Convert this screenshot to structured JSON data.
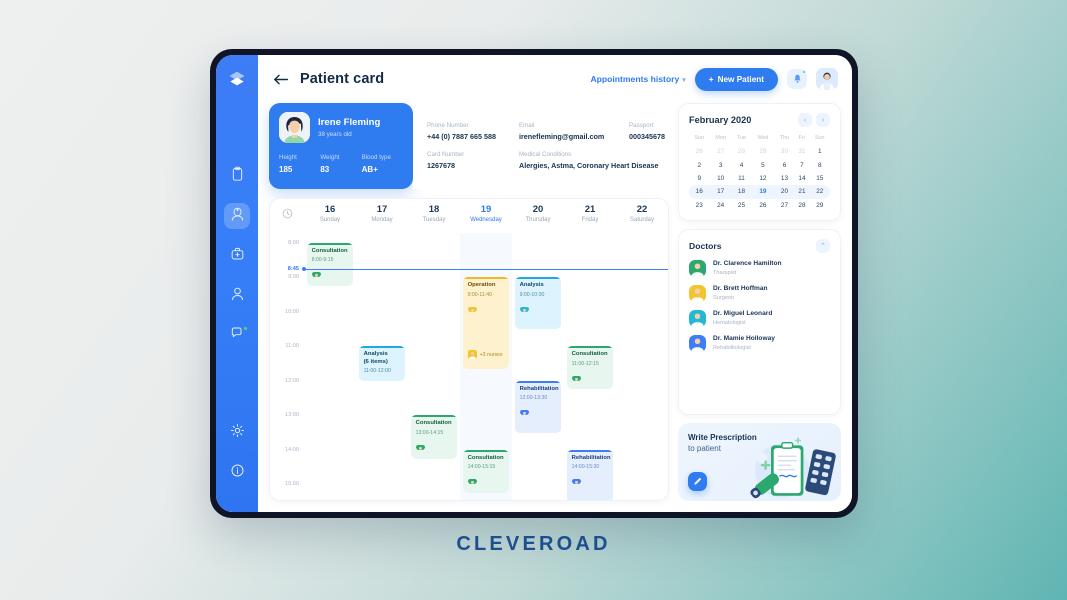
{
  "brand": "CLEVEROAD",
  "sidebar": {
    "logo_icon": "cleveroad-logo-icon",
    "items": [
      {
        "icon": "clipboard-icon",
        "name": "records",
        "active": false,
        "badge": false
      },
      {
        "icon": "nurse-icon",
        "name": "nurses",
        "active": true,
        "badge": false
      },
      {
        "icon": "medical-bag-icon",
        "name": "pharmacy",
        "active": false,
        "badge": false
      },
      {
        "icon": "doctor-icon",
        "name": "doctors",
        "active": false,
        "badge": false
      },
      {
        "icon": "chat-icon",
        "name": "messages",
        "active": false,
        "badge": true
      }
    ],
    "bottom_items": [
      {
        "icon": "gear-icon",
        "name": "settings"
      },
      {
        "icon": "info-icon",
        "name": "help"
      }
    ]
  },
  "topbar": {
    "back_icon": "arrow-left-icon",
    "title": "Patient card",
    "appointments_history": "Appointments history",
    "appointments_caret": "▾",
    "new_patient": "New Patient",
    "new_patient_plus": "+",
    "bell_icon": "bell-icon",
    "avatar_icon": "user-avatar"
  },
  "patient": {
    "name": "Irene Fleming",
    "age": "38 years old",
    "stats": [
      {
        "label": "Height",
        "value": "185"
      },
      {
        "label": "Weight",
        "value": "83"
      },
      {
        "label": "Blood type",
        "value": "AB+"
      }
    ],
    "details_row1": [
      {
        "label": "Phone Number",
        "value": "+44 (0) 7887 665 588"
      },
      {
        "label": "Email",
        "value": "irenefleming@gmail.com"
      },
      {
        "label": "Passport",
        "value": "000345678"
      }
    ],
    "details_row2": [
      {
        "label": "Card Number",
        "value": "1267678"
      },
      {
        "label": "Medical Conditions",
        "value": "Alergies, Astma, Coronary Heart Disease"
      }
    ]
  },
  "schedule": {
    "clock_icon": "clock-icon",
    "days": [
      {
        "num": "16",
        "name": "Sunday",
        "today": false
      },
      {
        "num": "17",
        "name": "Monday",
        "today": false
      },
      {
        "num": "18",
        "name": "Tuesday",
        "today": false
      },
      {
        "num": "19",
        "name": "Wednesday",
        "today": true
      },
      {
        "num": "20",
        "name": "Thursday",
        "today": false
      },
      {
        "num": "21",
        "name": "Friday",
        "today": false
      },
      {
        "num": "22",
        "name": "Saturday",
        "today": false
      }
    ],
    "time_labels": [
      "8:00",
      "9:00",
      "10:00",
      "11:00",
      "12:00",
      "13:00",
      "14:00",
      "15:00"
    ],
    "now_label": "8:45",
    "events": [
      {
        "title": "Consultation",
        "sub": "",
        "time": "8:00-9:15",
        "day": 0,
        "start": 8.0,
        "end": 9.25,
        "color": "green",
        "avatar": "doctor-green-avatar"
      },
      {
        "title": "Operation",
        "sub": "",
        "time": "9:00-11:40",
        "day": 3,
        "start": 9.0,
        "end": 11.67,
        "color": "yellow",
        "avatar": "nurse-yellow-avatar",
        "nurses": "+3 nurses"
      },
      {
        "title": "Analysis",
        "sub": "",
        "time": "9:00-10:30",
        "day": 4,
        "start": 9.0,
        "end": 10.5,
        "color": "cyan",
        "avatar": "doctor-cyan-avatar"
      },
      {
        "title": "Analysis",
        "sub": "(6 items)",
        "time": "11:00-12:00",
        "day": 1,
        "start": 11.0,
        "end": 12.0,
        "color": "cyan",
        "avatar": "doctor-cyan-avatar"
      },
      {
        "title": "Consultation",
        "sub": "",
        "time": "11:00-12:15",
        "day": 5,
        "start": 11.0,
        "end": 12.25,
        "color": "green",
        "avatar": "doctor-green-avatar"
      },
      {
        "title": "Rehabilitation",
        "sub": "",
        "time": "12:00-13:30",
        "day": 4,
        "start": 12.0,
        "end": 13.5,
        "color": "blue",
        "avatar": "doctor-blue-avatar"
      },
      {
        "title": "Consultation",
        "sub": "",
        "time": "13:00-14:15",
        "day": 2,
        "start": 13.0,
        "end": 14.25,
        "color": "green",
        "avatar": "doctor-green-avatar"
      },
      {
        "title": "Consultation",
        "sub": "",
        "time": "14:00-15:15",
        "day": 3,
        "start": 14.0,
        "end": 15.25,
        "color": "green",
        "avatar": "doctor-green-avatar"
      },
      {
        "title": "Rehabilitation",
        "sub": "",
        "time": "14:00-15:30",
        "day": 5,
        "start": 14.0,
        "end": 15.5,
        "color": "blue",
        "avatar": "doctor-blue-avatar"
      }
    ]
  },
  "calendar": {
    "month": "February 2020",
    "prev_icon": "chevron-left-icon",
    "next_icon": "chevron-right-icon",
    "weekdays": [
      "Sun",
      "Mon",
      "Tue",
      "Wed",
      "Thu",
      "Fri",
      "Sun"
    ],
    "weeks": [
      [
        {
          "d": "26",
          "mute": true
        },
        {
          "d": "27",
          "mute": true
        },
        {
          "d": "28",
          "mute": true
        },
        {
          "d": "29",
          "mute": true
        },
        {
          "d": "30",
          "mute": true
        },
        {
          "d": "31",
          "mute": true
        },
        {
          "d": "1",
          "mute": false
        }
      ],
      [
        {
          "d": "2",
          "mute": false
        },
        {
          "d": "3",
          "mute": false
        },
        {
          "d": "4",
          "mute": false
        },
        {
          "d": "5",
          "mute": false
        },
        {
          "d": "6",
          "mute": false
        },
        {
          "d": "7",
          "mute": false
        },
        {
          "d": "8",
          "mute": false
        }
      ],
      [
        {
          "d": "9",
          "mute": false
        },
        {
          "d": "10",
          "mute": false
        },
        {
          "d": "11",
          "mute": false
        },
        {
          "d": "12",
          "mute": false
        },
        {
          "d": "13",
          "mute": false
        },
        {
          "d": "14",
          "mute": false
        },
        {
          "d": "15",
          "mute": false
        }
      ],
      [
        {
          "d": "16",
          "mute": false
        },
        {
          "d": "17",
          "mute": false
        },
        {
          "d": "18",
          "mute": false
        },
        {
          "d": "19",
          "mute": false,
          "today": true
        },
        {
          "d": "20",
          "mute": false
        },
        {
          "d": "21",
          "mute": false
        },
        {
          "d": "22",
          "mute": false
        }
      ],
      [
        {
          "d": "23",
          "mute": false
        },
        {
          "d": "24",
          "mute": false
        },
        {
          "d": "25",
          "mute": false
        },
        {
          "d": "26",
          "mute": false
        },
        {
          "d": "27",
          "mute": false
        },
        {
          "d": "28",
          "mute": false
        },
        {
          "d": "29",
          "mute": false
        }
      ]
    ],
    "selected_week_index": 3
  },
  "doctors": {
    "title": "Doctors",
    "collapse_icon": "chevron-up-icon",
    "list": [
      {
        "name": "Dr. Clarence Hamilton",
        "specialty": "Tharapist",
        "avatar_color": "#2aa86d"
      },
      {
        "name": "Dr. Brett Hoffman",
        "specialty": "Surgeon",
        "avatar_color": "#f4c430"
      },
      {
        "name": "Dr. Miguel Leonard",
        "specialty": "Hematologist",
        "avatar_color": "#22b8d6"
      },
      {
        "name": "Dr. Mamie Holloway",
        "specialty": "Rehabilitologist",
        "avatar_color": "#3d7df6"
      }
    ]
  },
  "prescription": {
    "title": "Write Prescription",
    "subtitle": "to patient",
    "button_icon": "pencil-icon",
    "art_icon": "prescription-illustration"
  },
  "colors": {
    "accent": "#2f7bf0",
    "rail": "#3d7df6",
    "green": "#2aa86d",
    "yellow": "#f0b728",
    "cyan": "#22a8e0",
    "blue": "#3d7df6",
    "badge_green": "#3ddc84",
    "brand_text": "#1d4f8f"
  }
}
